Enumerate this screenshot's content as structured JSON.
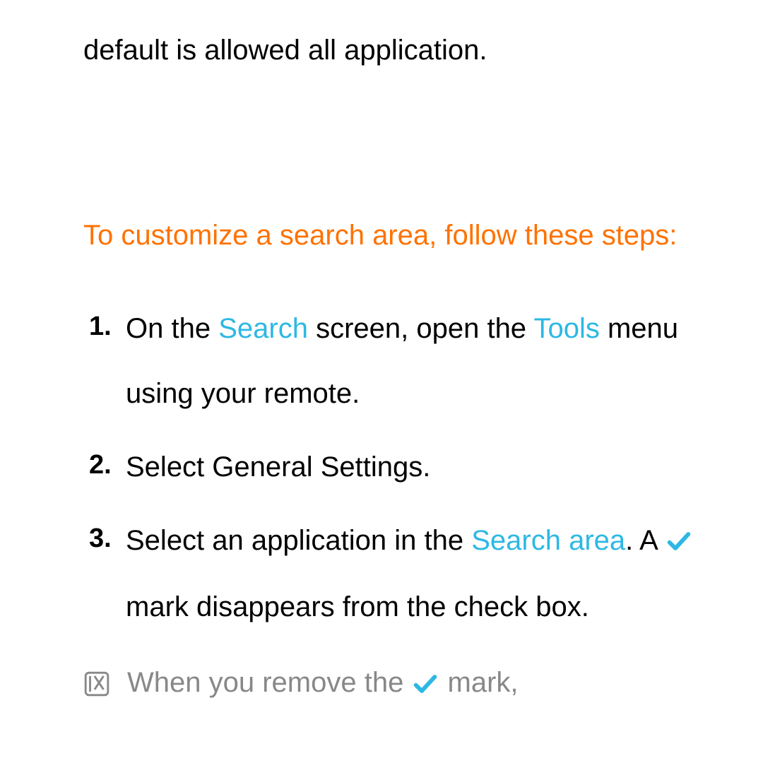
{
  "intro": "default is allowed all application.",
  "heading": "To customize a search area, follow these steps:",
  "steps": {
    "1": {
      "pre": "On the ",
      "hl1": "Search",
      "mid": " screen, open the ",
      "hl2": "Tools",
      "post": " menu using your remote."
    },
    "2": "Select General Settings.",
    "3": {
      "pre": "Select an application in the ",
      "hl": "Search area",
      "post1": ". A ",
      "post2": " mark disappears from the check box."
    }
  },
  "note": {
    "pre": "When you remove the ",
    "post": " mark,"
  }
}
